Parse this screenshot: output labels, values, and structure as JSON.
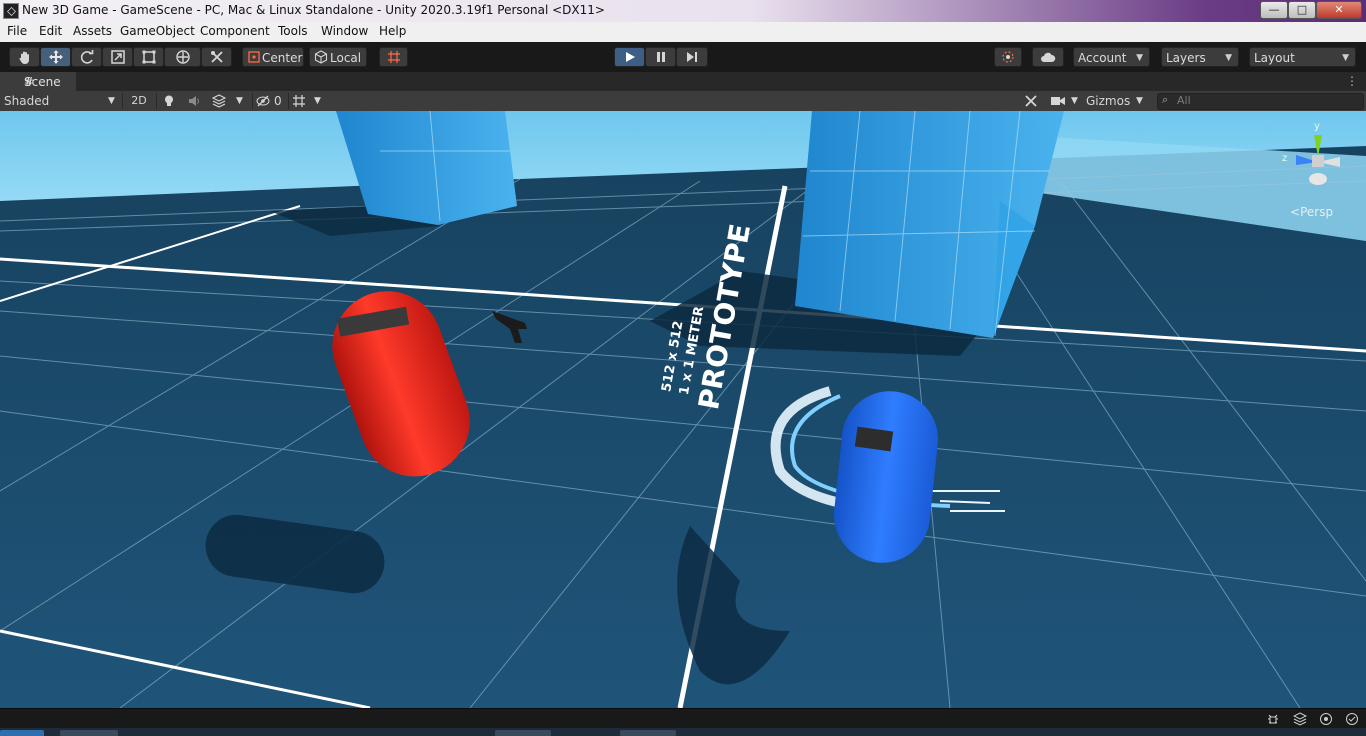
{
  "window": {
    "title": "New 3D Game - GameScene - PC, Mac & Linux Standalone - Unity 2020.3.19f1 Personal <DX11>",
    "buttons": {
      "minimize": "—",
      "maximize": "□",
      "close": "✕"
    }
  },
  "menu": {
    "items": [
      "File",
      "Edit",
      "Assets",
      "GameObject",
      "Component",
      "Tools",
      "Window",
      "Help"
    ]
  },
  "toolbar": {
    "tools": [
      "hand-tool-icon",
      "move-tool-icon",
      "rotate-tool-icon",
      "scale-tool-icon",
      "rect-tool-icon",
      "transform-tool-icon",
      "custom-tool-icon"
    ],
    "pivot_label": "Center",
    "space_label": "Local",
    "account_label": "Account",
    "layers_label": "Layers",
    "layout_label": "Layout"
  },
  "scene_tab": {
    "label": "Scene"
  },
  "scene_toolbar": {
    "draw_mode": "Shaded",
    "mode_2d": "2D",
    "hidden_count": "0",
    "gizmos_label": "Gizmos",
    "search_placeholder": "All"
  },
  "viewport": {
    "projection_label": "Persp",
    "prototype_texture": {
      "title": "PROTOTYPE",
      "line1": "1 x 1 METER",
      "line2": "512 x 512"
    },
    "axis_labels": {
      "z": "z",
      "y": "y"
    },
    "colors": {
      "sky": "#7fd2f3",
      "floor": "#1d4c6e",
      "grid": "#ffffff",
      "red_capsule": "#e5241c",
      "blue_capsule": "#1f6ef0",
      "pillar": "#2f9be0"
    }
  }
}
